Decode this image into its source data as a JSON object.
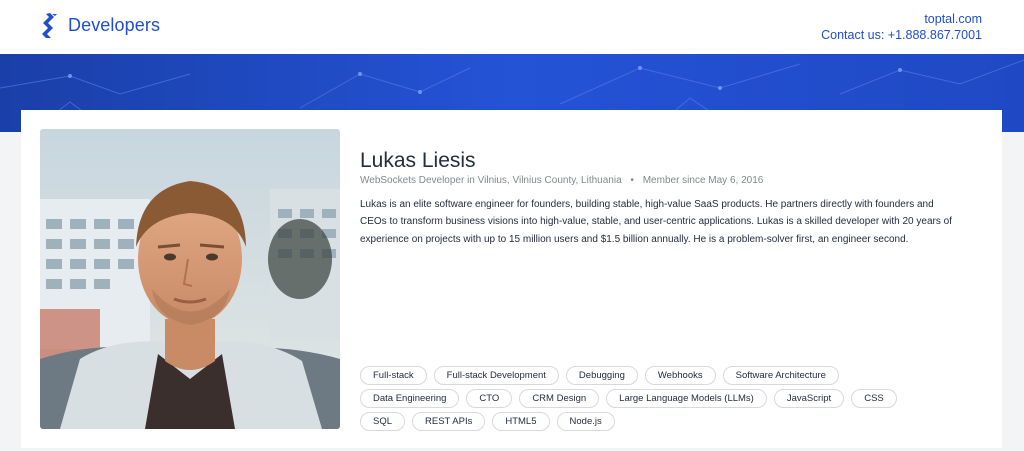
{
  "header": {
    "logo_text": "Developers",
    "site_link": "toptal.com",
    "contact": "Contact us: +1.888.867.7001"
  },
  "profile": {
    "name": "Lukas Liesis",
    "role_location": "WebSockets Developer in Vilnius, Vilnius County, Lithuania",
    "separator": "•",
    "member_since": "Member since May 6, 2016",
    "bio": "Lukas is an elite software engineer for founders, building stable, high-value SaaS products. He partners directly with founders and CEOs to transform business visions into high-value, stable, and user-centric applications. Lukas is a skilled developer with 20 years of experience on projects with up to 15 million users and $1.5 billion annually. He is a problem-solver first, an engineer second.",
    "skills": [
      [
        "Full-stack",
        "Full-stack Development",
        "Debugging",
        "Webhooks",
        "Software Architecture"
      ],
      [
        "Data Engineering",
        "CTO",
        "CRM Design",
        "Large Language Models (LLMs)",
        "JavaScript",
        "CSS"
      ],
      [
        "SQL",
        "REST APIs",
        "HTML5",
        "Node.js"
      ]
    ]
  },
  "colors": {
    "brand": "#204ecf",
    "banner": "#2453d6",
    "text": "#262d3d",
    "muted": "#84888e"
  }
}
